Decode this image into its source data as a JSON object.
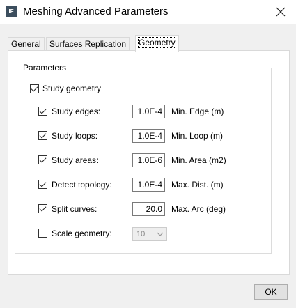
{
  "window": {
    "title": "Meshing Advanced Parameters",
    "icon_text": "IF",
    "close_icon": "close-icon"
  },
  "tabs": [
    {
      "label": "General",
      "active": false
    },
    {
      "label": "Surfaces Replication",
      "active": false
    },
    {
      "label": "Geometry",
      "active": true
    }
  ],
  "parameters": {
    "group_label": "Parameters",
    "study_geometry": {
      "label": "Study geometry",
      "checked": true
    },
    "rows": [
      {
        "label": "Study edges:",
        "checked": true,
        "value": "1.0E-4",
        "unit": "Min. Edge (m)"
      },
      {
        "label": "Study loops:",
        "checked": true,
        "value": "1.0E-4",
        "unit": "Min. Loop (m)"
      },
      {
        "label": "Study areas:",
        "checked": true,
        "value": "1.0E-6",
        "unit": "Min. Area (m2)"
      },
      {
        "label": "Detect topology:",
        "checked": true,
        "value": "1.0E-4",
        "unit": "Max. Dist. (m)"
      },
      {
        "label": "Split curves:",
        "checked": true,
        "value": "20.0",
        "unit": "Max. Arc (deg)"
      }
    ],
    "scale_geometry": {
      "label": "Scale geometry:",
      "checked": false,
      "value": "10",
      "enabled": false
    }
  },
  "buttons": {
    "ok": "OK"
  }
}
